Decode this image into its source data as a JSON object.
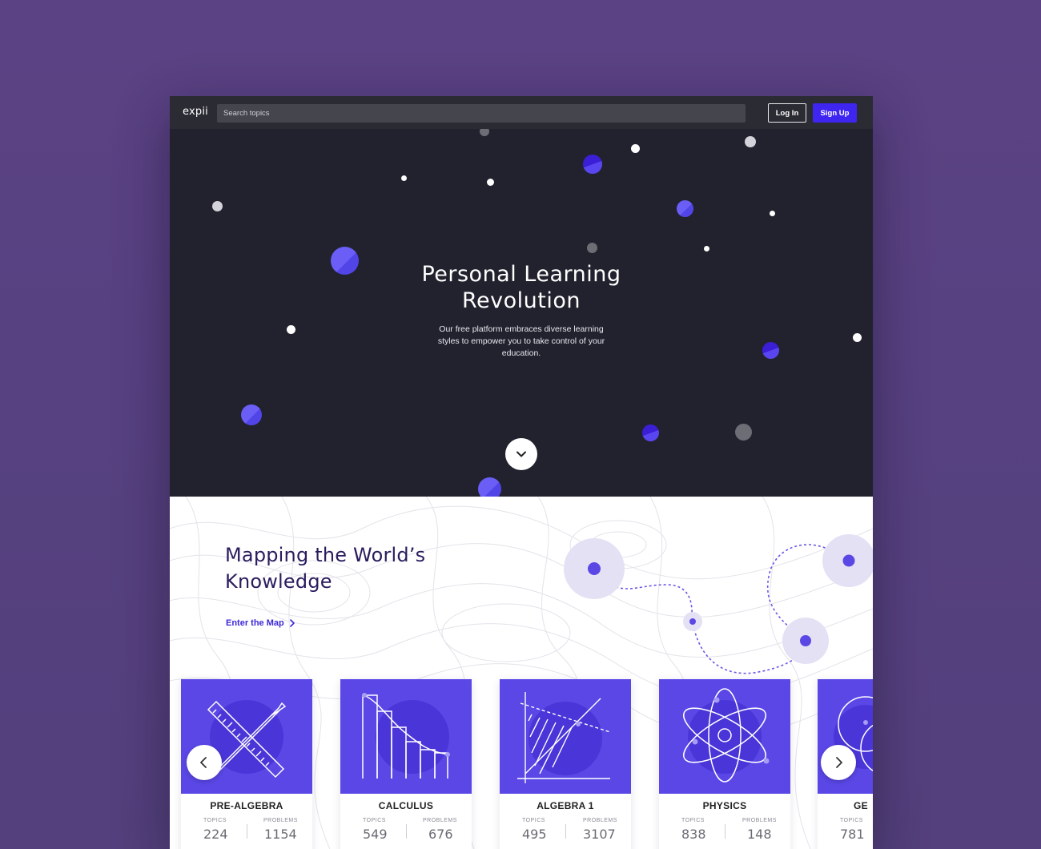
{
  "header": {
    "logo": "expii",
    "search_placeholder": "Search topics",
    "login_label": "Log In",
    "signup_label": "Sign Up"
  },
  "hero": {
    "title": "Personal Learning Revolution",
    "subtitle": "Our free platform embraces diverse learning styles to empower you to take control of your education."
  },
  "map_section": {
    "title": "Mapping the World’s Knowledge",
    "link_label": "Enter the Map"
  },
  "cards": [
    {
      "title": "PRE-ALGEBRA",
      "topics_label": "TOPICS",
      "topics": "224",
      "problems_label": "PROBLEMS",
      "problems": "1154"
    },
    {
      "title": "CALCULUS",
      "topics_label": "TOPICS",
      "topics": "549",
      "problems_label": "PROBLEMS",
      "problems": "676"
    },
    {
      "title": "ALGEBRA 1",
      "topics_label": "TOPICS",
      "topics": "495",
      "problems_label": "PROBLEMS",
      "problems": "3107"
    },
    {
      "title": "PHYSICS",
      "topics_label": "TOPICS",
      "topics": "838",
      "problems_label": "PROBLEMS",
      "problems": "148"
    },
    {
      "title": "GE",
      "topics_label": "TOPICS",
      "topics": "781",
      "problems_label": "",
      "problems": ""
    }
  ],
  "colors": {
    "accent": "#3f25f0",
    "card_bg": "#5a47e6",
    "hero_bg": "#22222f",
    "page_bg": "#553f80"
  },
  "icons": [
    "chevron-down-icon",
    "chevron-right-icon",
    "chevron-left-icon"
  ]
}
